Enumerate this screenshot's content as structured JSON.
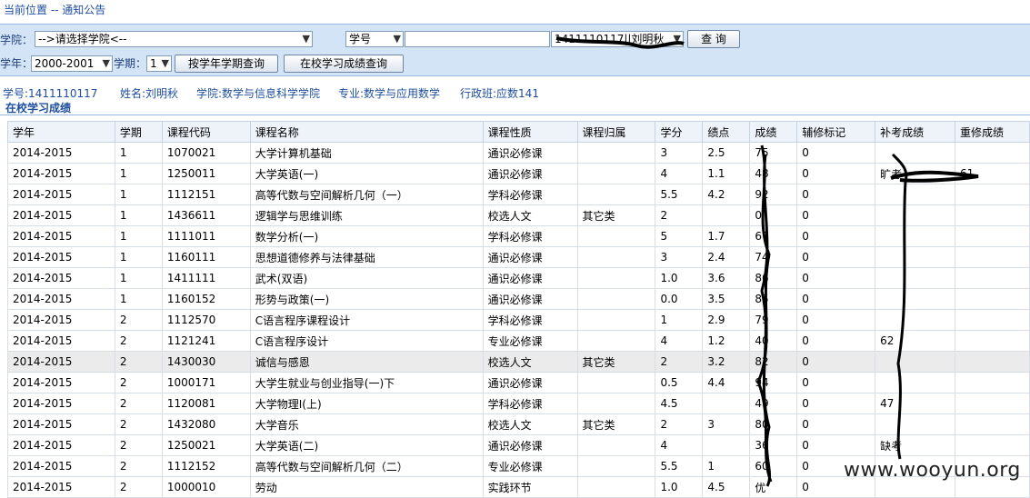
{
  "breadcrumb": "当前位置 -- 通知公告",
  "filters": {
    "college_label": "学院：",
    "college_value": "-->请选择学院<--",
    "field_select": "学号",
    "query_input": "",
    "student_select": "1411110117||刘明秋",
    "query_button": "查 询",
    "year_label": "学年：",
    "year_value": "2000-2001",
    "term_label": "学期：",
    "term_value": "1",
    "term_query_button": "按学年学期查询",
    "school_query_button": "在校学习成绩查询"
  },
  "student": {
    "id": "学号:1411110117",
    "name": "姓名:刘明秋",
    "college": "学院:数学与信息科学学院",
    "major": "专业:数学与应用数学",
    "class": "行政班:应数141"
  },
  "section_title": "在校学习成绩",
  "table": {
    "headers": [
      "学年",
      "学期",
      "课程代码",
      "课程名称",
      "课程性质",
      "课程归属",
      "学分",
      "绩点",
      "成绩",
      "辅修标记",
      "补考成绩",
      "重修成绩"
    ],
    "rows": [
      [
        "2014-2015",
        "1",
        "1070021",
        "大学计算机基础",
        "通识必修课",
        "",
        "3",
        "2.5",
        "75",
        "0",
        "",
        ""
      ],
      [
        "2014-2015",
        "1",
        "1250011",
        "大学英语(一)",
        "通识必修课",
        "",
        "4",
        "1.1",
        "48",
        "0",
        "旷考",
        "61"
      ],
      [
        "2014-2015",
        "1",
        "1112151",
        "高等代数与空间解析几何（一）",
        "学科必修课",
        "",
        "5.5",
        "4.2",
        "92",
        "0",
        "",
        ""
      ],
      [
        "2014-2015",
        "1",
        "1436611",
        "逻辑学与思维训练",
        "校选人文",
        "其它类",
        "2",
        "",
        "0",
        "0",
        "",
        ""
      ],
      [
        "2014-2015",
        "1",
        "1111011",
        "数学分析(一)",
        "学科必修课",
        "",
        "5",
        "1.7",
        "67",
        "0",
        "",
        ""
      ],
      [
        "2014-2015",
        "1",
        "1160111",
        "思想道德修养与法律基础",
        "通识必修课",
        "",
        "3",
        "2.4",
        "74",
        "0",
        "",
        ""
      ],
      [
        "2014-2015",
        "1",
        "1411111",
        "武术(双语)",
        "通识必修课",
        "",
        "1.0",
        "3.6",
        "86",
        "0",
        "",
        ""
      ],
      [
        "2014-2015",
        "1",
        "1160152",
        "形势与政策(一)",
        "通识必修课",
        "",
        "0.0",
        "3.5",
        "85",
        "0",
        "",
        ""
      ],
      [
        "2014-2015",
        "2",
        "1112570",
        "C语言程序课程设计",
        "学科必修课",
        "",
        "1",
        "2.9",
        "79",
        "0",
        "",
        ""
      ],
      [
        "2014-2015",
        "2",
        "1121241",
        "C语言程序设计",
        "专业必修课",
        "",
        "4",
        "1.2",
        "40",
        "0",
        "62",
        ""
      ],
      [
        "2014-2015",
        "2",
        "1430030",
        "诚信与感恩",
        "校选人文",
        "其它类",
        "2",
        "3.2",
        "82",
        "0",
        "",
        ""
      ],
      [
        "2014-2015",
        "2",
        "1000171",
        "大学生就业与创业指导(一)下",
        "通识必修课",
        "",
        "0.5",
        "4.4",
        "94",
        "0",
        "",
        ""
      ],
      [
        "2014-2015",
        "2",
        "1120081",
        "大学物理Ⅰ(上)",
        "学科必修课",
        "",
        "4.5",
        "",
        "49",
        "0",
        "47",
        ""
      ],
      [
        "2014-2015",
        "2",
        "1432080",
        "大学音乐",
        "校选人文",
        "其它类",
        "2",
        "3",
        "80",
        "0",
        "",
        ""
      ],
      [
        "2014-2015",
        "2",
        "1250021",
        "大学英语(二)",
        "通识必修课",
        "",
        "4",
        "",
        "36",
        "0",
        "缺考",
        ""
      ],
      [
        "2014-2015",
        "2",
        "1112152",
        "高等代数与空间解析几何（二）",
        "专业必修课",
        "",
        "5.5",
        "1",
        "60",
        "0",
        "",
        ""
      ],
      [
        "2014-2015",
        "2",
        "1000010",
        "劳动",
        "实践环节",
        "",
        "1.0",
        "4.5",
        "优",
        "0",
        "",
        ""
      ]
    ]
  },
  "watermark": "www.wooyun.org"
}
